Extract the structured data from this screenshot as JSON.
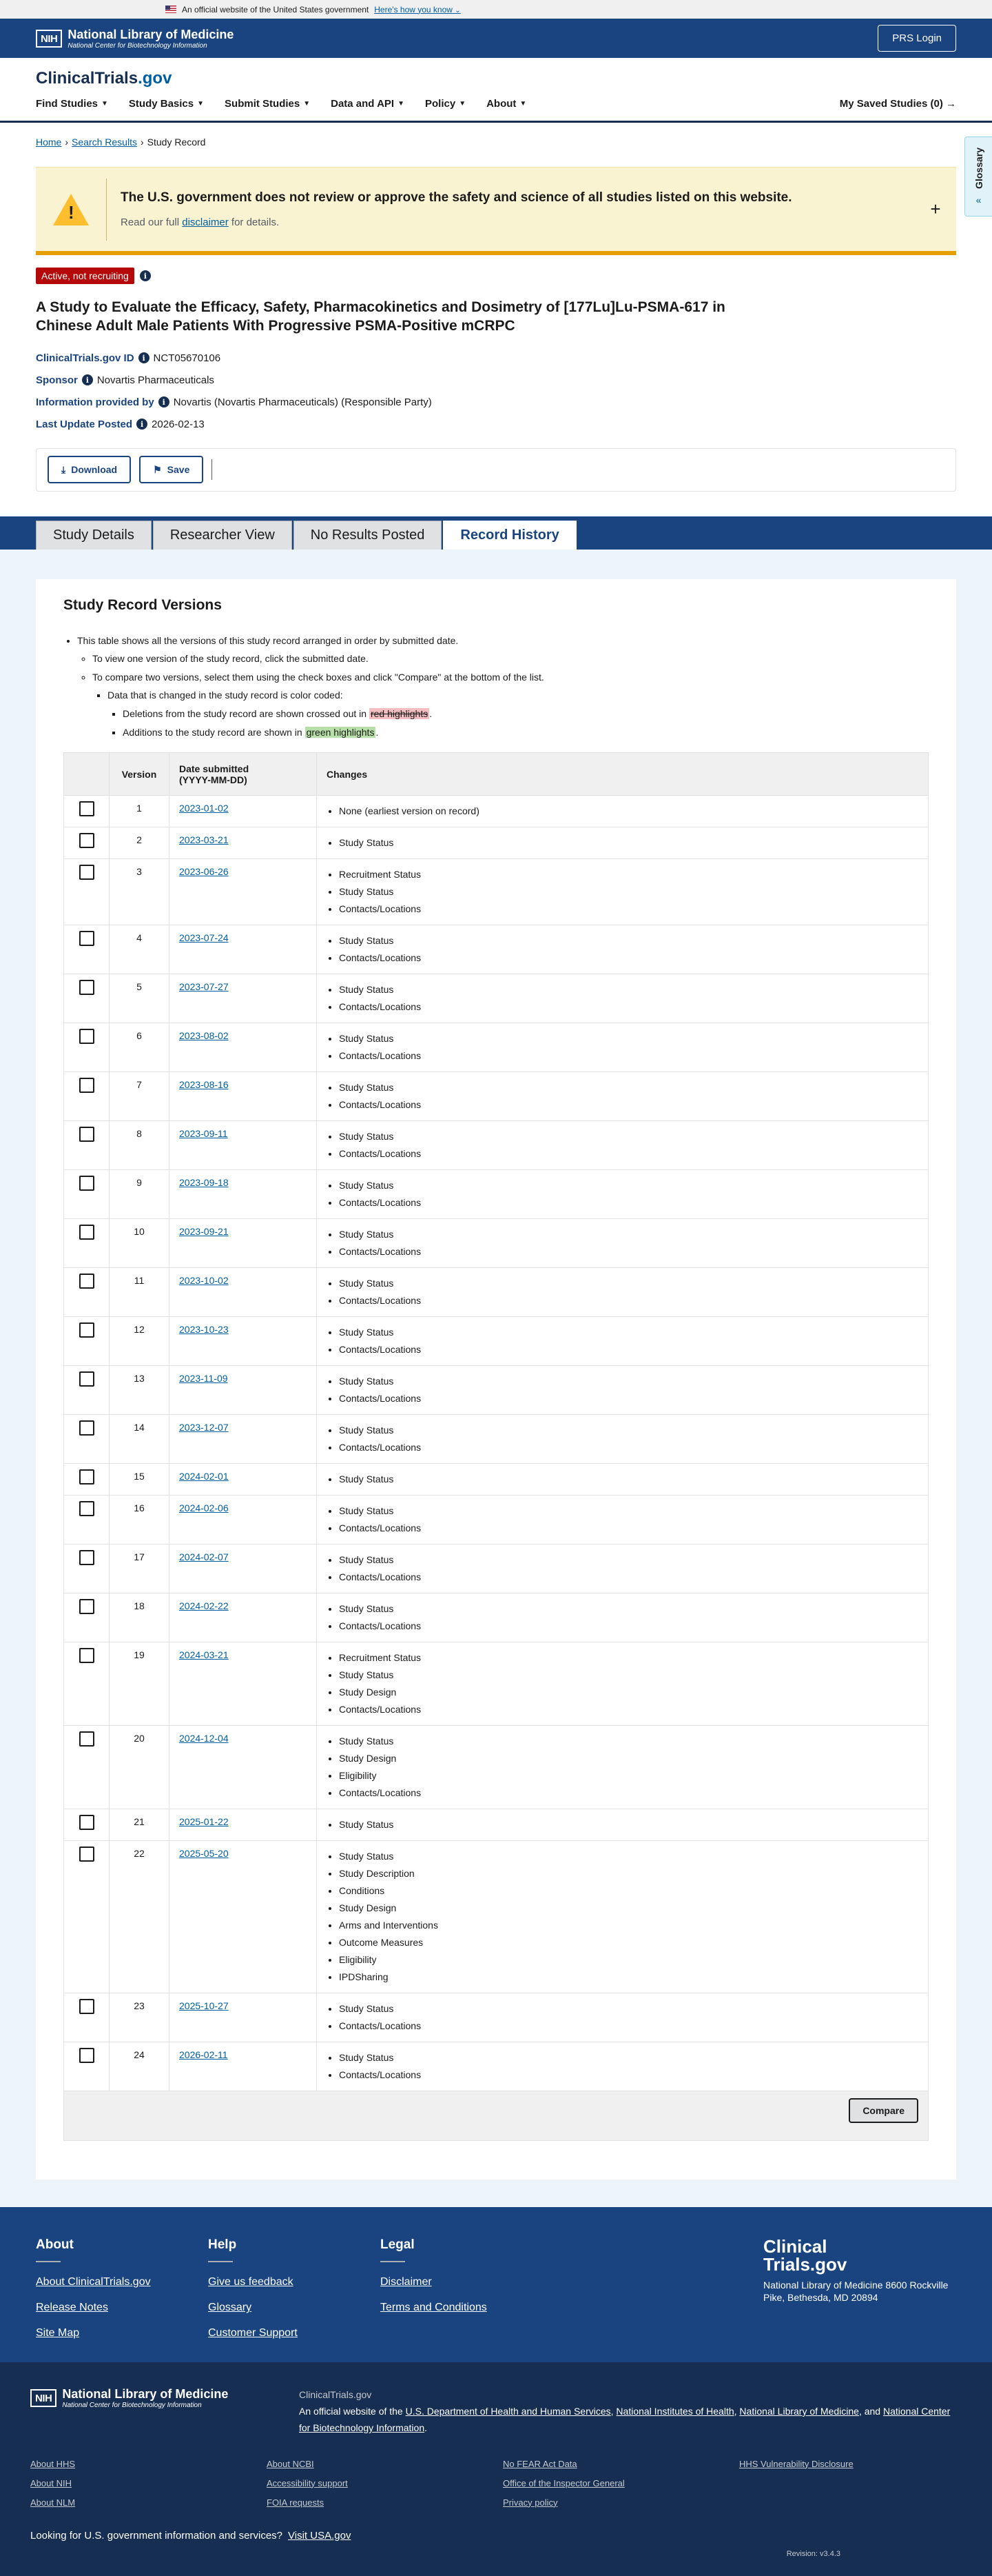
{
  "gov_banner": {
    "text": "An official website of the United States government",
    "link": "Here's how you know"
  },
  "nlm_header": {
    "logo": "NIH",
    "title": "National Library of Medicine",
    "subtitle": "National Center for Biotechnology Information",
    "prs_button": "PRS Login"
  },
  "site": {
    "title_main": "ClinicalTrials",
    "title_suffix": ".gov",
    "nav": [
      "Find Studies",
      "Study Basics",
      "Submit Studies",
      "Data and API",
      "Policy",
      "About"
    ],
    "saved": "My Saved Studies (0)"
  },
  "breadcrumb": {
    "home": "Home",
    "search": "Search Results",
    "current": "Study Record"
  },
  "glossary_tab": "Glossary",
  "disclaimer": {
    "title": "The U.S. government does not review or approve the safety and science of all studies listed on this website.",
    "prefix": "Read our full",
    "link": "disclaimer",
    "suffix": "for details."
  },
  "study": {
    "status": "Active, not recruiting",
    "title": "A Study to Evaluate the Efficacy, Safety, Pharmacokinetics and Dosimetry of [177Lu]Lu-PSMA-617 in Chinese Adult Male Patients With Progressive PSMA-Positive mCRPC",
    "id_label": "ClinicalTrials.gov ID",
    "id_value": "NCT05670106",
    "sponsor_label": "Sponsor",
    "sponsor_value": "Novartis Pharmaceuticals",
    "info_label": "Information provided by",
    "info_value": "Novartis (Novartis Pharmaceuticals) (Responsible Party)",
    "update_label": "Last Update Posted",
    "update_value": "2026-02-13"
  },
  "actions": {
    "download": "Download",
    "save": "Save"
  },
  "tabs": [
    "Study Details",
    "Researcher View",
    "No Results Posted",
    "Record History"
  ],
  "record": {
    "title": "Study Record Versions",
    "intro1": "This table shows all the versions of this study record arranged in order by submitted date.",
    "intro2": "To view one version of the study record, click the submitted date.",
    "intro3": "To compare two versions, select them using the check boxes and click \"Compare\" at the bottom of the list.",
    "intro4": "Data that is changed in the study record is color coded:",
    "del_prefix": "Deletions from the study record are shown crossed out in",
    "del_hl": "red highlights",
    "add_prefix": "Additions to the study record are shown in",
    "add_hl": "green highlights",
    "col_version": "Version",
    "col_date_1": "Date submitted",
    "col_date_2": "(YYYY-MM-DD)",
    "col_changes": "Changes",
    "compare": "Compare",
    "rows": [
      {
        "v": "1",
        "d": "2023-01-02",
        "c": [
          "None (earliest version on record)"
        ]
      },
      {
        "v": "2",
        "d": "2023-03-21",
        "c": [
          "Study Status"
        ]
      },
      {
        "v": "3",
        "d": "2023-06-26",
        "c": [
          "Recruitment Status",
          "Study Status",
          "Contacts/Locations"
        ]
      },
      {
        "v": "4",
        "d": "2023-07-24",
        "c": [
          "Study Status",
          "Contacts/Locations"
        ]
      },
      {
        "v": "5",
        "d": "2023-07-27",
        "c": [
          "Study Status",
          "Contacts/Locations"
        ]
      },
      {
        "v": "6",
        "d": "2023-08-02",
        "c": [
          "Study Status",
          "Contacts/Locations"
        ]
      },
      {
        "v": "7",
        "d": "2023-08-16",
        "c": [
          "Study Status",
          "Contacts/Locations"
        ]
      },
      {
        "v": "8",
        "d": "2023-09-11",
        "c": [
          "Study Status",
          "Contacts/Locations"
        ]
      },
      {
        "v": "9",
        "d": "2023-09-18",
        "c": [
          "Study Status",
          "Contacts/Locations"
        ]
      },
      {
        "v": "10",
        "d": "2023-09-21",
        "c": [
          "Study Status",
          "Contacts/Locations"
        ]
      },
      {
        "v": "11",
        "d": "2023-10-02",
        "c": [
          "Study Status",
          "Contacts/Locations"
        ]
      },
      {
        "v": "12",
        "d": "2023-10-23",
        "c": [
          "Study Status",
          "Contacts/Locations"
        ]
      },
      {
        "v": "13",
        "d": "2023-11-09",
        "c": [
          "Study Status",
          "Contacts/Locations"
        ]
      },
      {
        "v": "14",
        "d": "2023-12-07",
        "c": [
          "Study Status",
          "Contacts/Locations"
        ]
      },
      {
        "v": "15",
        "d": "2024-02-01",
        "c": [
          "Study Status"
        ]
      },
      {
        "v": "16",
        "d": "2024-02-06",
        "c": [
          "Study Status",
          "Contacts/Locations"
        ]
      },
      {
        "v": "17",
        "d": "2024-02-07",
        "c": [
          "Study Status",
          "Contacts/Locations"
        ]
      },
      {
        "v": "18",
        "d": "2024-02-22",
        "c": [
          "Study Status",
          "Contacts/Locations"
        ]
      },
      {
        "v": "19",
        "d": "2024-03-21",
        "c": [
          "Recruitment Status",
          "Study Status",
          "Study Design",
          "Contacts/Locations"
        ]
      },
      {
        "v": "20",
        "d": "2024-12-04",
        "c": [
          "Study Status",
          "Study Design",
          "Eligibility",
          "Contacts/Locations"
        ]
      },
      {
        "v": "21",
        "d": "2025-01-22",
        "c": [
          "Study Status"
        ]
      },
      {
        "v": "22",
        "d": "2025-05-20",
        "c": [
          "Study Status",
          "Study Description",
          "Conditions",
          "Study Design",
          "Arms and Interventions",
          "Outcome Measures",
          "Eligibility",
          "IPDSharing"
        ]
      },
      {
        "v": "23",
        "d": "2025-10-27",
        "c": [
          "Study Status",
          "Contacts/Locations"
        ]
      },
      {
        "v": "24",
        "d": "2026-02-11",
        "c": [
          "Study Status",
          "Contacts/Locations"
        ]
      }
    ]
  },
  "footer": {
    "cols": [
      {
        "title": "About",
        "links": [
          "About ClinicalTrials.gov",
          "Release Notes",
          "Site Map"
        ]
      },
      {
        "title": "Help",
        "links": [
          "Give us feedback",
          "Glossary",
          "Customer Support"
        ]
      },
      {
        "title": "Legal",
        "links": [
          "Disclaimer",
          "Terms and Conditions"
        ]
      }
    ],
    "brand_line1": "Clinical",
    "brand_line2": "Trials.gov",
    "address": "National Library of Medicine 8600 Rockville Pike, Bethesda, MD 20894"
  },
  "nlm_footer": {
    "logo": "NIH",
    "title": "National Library of Medicine",
    "subtitle": "National Center for Biotechnology Information",
    "ct": "ClinicalTrials.gov",
    "official_prefix": "An official website of the",
    "dhhs": "U.S. Department of Health and Human Services",
    "nih": "National Institutes of Health",
    "nlm": "National Library of Medicine",
    "and": ", and",
    "ncbi": "National Center for Biotechnology Information",
    "links": [
      "About HHS",
      "About NCBI",
      "No FEAR Act Data",
      "HHS Vulnerability Disclosure",
      "About NIH",
      "Accessibility support",
      "Office of the Inspector General",
      "About NLM",
      "FOIA requests",
      "Privacy policy"
    ],
    "gov_text": "Looking for U.S. government information and services?",
    "gov_link": "Visit USA.gov",
    "revision": "Revision: v3.4.3"
  }
}
